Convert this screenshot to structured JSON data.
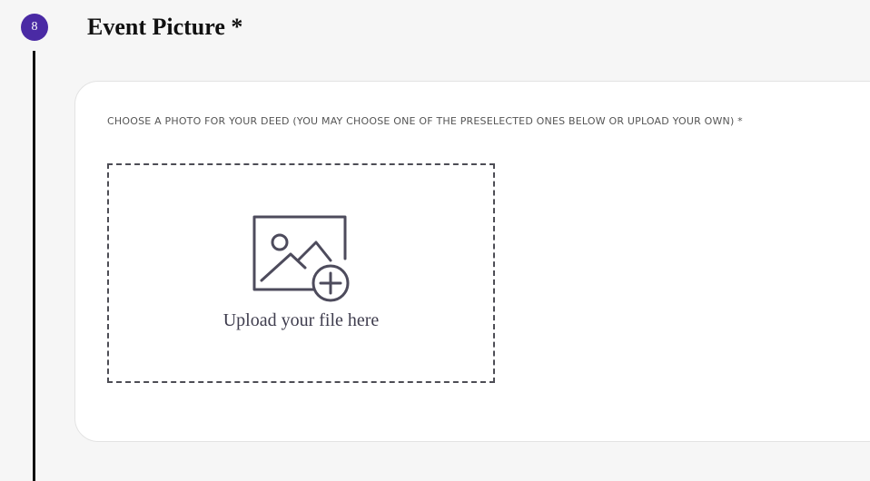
{
  "step": {
    "number": "8",
    "title": "Event Picture *"
  },
  "photo_field": {
    "label": "CHOOSE A PHOTO FOR YOUR DEED (YOU MAY CHOOSE ONE OF THE PRESELECTED ONES BELOW OR UPLOAD YOUR OWN) *",
    "upload_text": "Upload your file here",
    "upload_icon": "image-add-icon"
  },
  "colors": {
    "step_badge": "#4a2aa4",
    "icon_stroke": "#4d4b5c",
    "page_background": "#f6f6f6"
  }
}
